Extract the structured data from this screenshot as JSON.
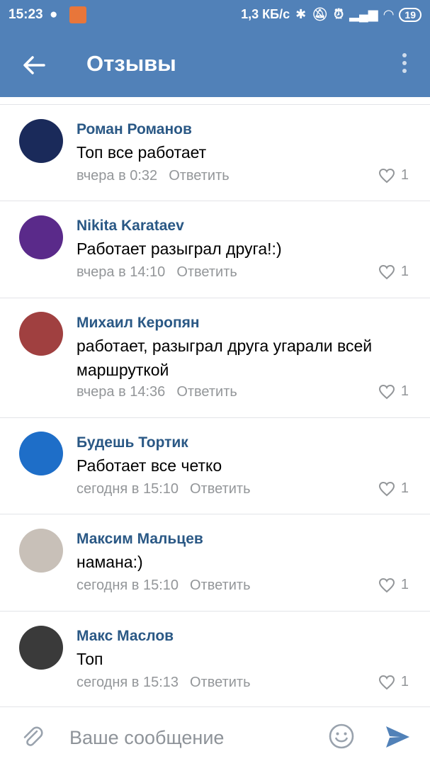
{
  "status_bar": {
    "time": "15:23",
    "network_speed": "1,3 КБ/с",
    "battery": "19"
  },
  "header": {
    "title": "Отзывы"
  },
  "comments": [
    {
      "author": "Роман Романов",
      "text": "Топ все работает",
      "time": "вчера в 0:32",
      "reply_label": "Ответить",
      "likes": "1",
      "avatar_color": "#1a2a5a"
    },
    {
      "author": "Nikita Karataev",
      "text": "Работает разыграл друга!:)",
      "time": "вчера в 14:10",
      "reply_label": "Ответить",
      "likes": "1",
      "avatar_color": "#5a2a8a"
    },
    {
      "author": "Михаил Керопян",
      "text": "работает, разыграл друга угарали всей маршруткой",
      "time": "вчера в 14:36",
      "reply_label": "Ответить",
      "likes": "1",
      "avatar_color": "#a04040"
    },
    {
      "author": "Будешь Тортик",
      "text": "Работает все четко",
      "time": "сегодня в 15:10",
      "reply_label": "Ответить",
      "likes": "1",
      "avatar_color": "#1e6ec8"
    },
    {
      "author": "Максим Мальцев",
      "text": "намана:)",
      "time": "сегодня в 15:10",
      "reply_label": "Ответить",
      "likes": "1",
      "avatar_color": "#c8c0b8"
    },
    {
      "author": "Макс Маслов",
      "text": "Топ",
      "time": "сегодня в 15:13",
      "reply_label": "Ответить",
      "likes": "1",
      "avatar_color": "#3a3a3a"
    }
  ],
  "composer": {
    "placeholder": "Ваше сообщение"
  },
  "colors": {
    "header_bg": "#5181b8",
    "author_name": "#2a5885",
    "meta_text": "#939699",
    "send_icon": "#5181b8"
  }
}
